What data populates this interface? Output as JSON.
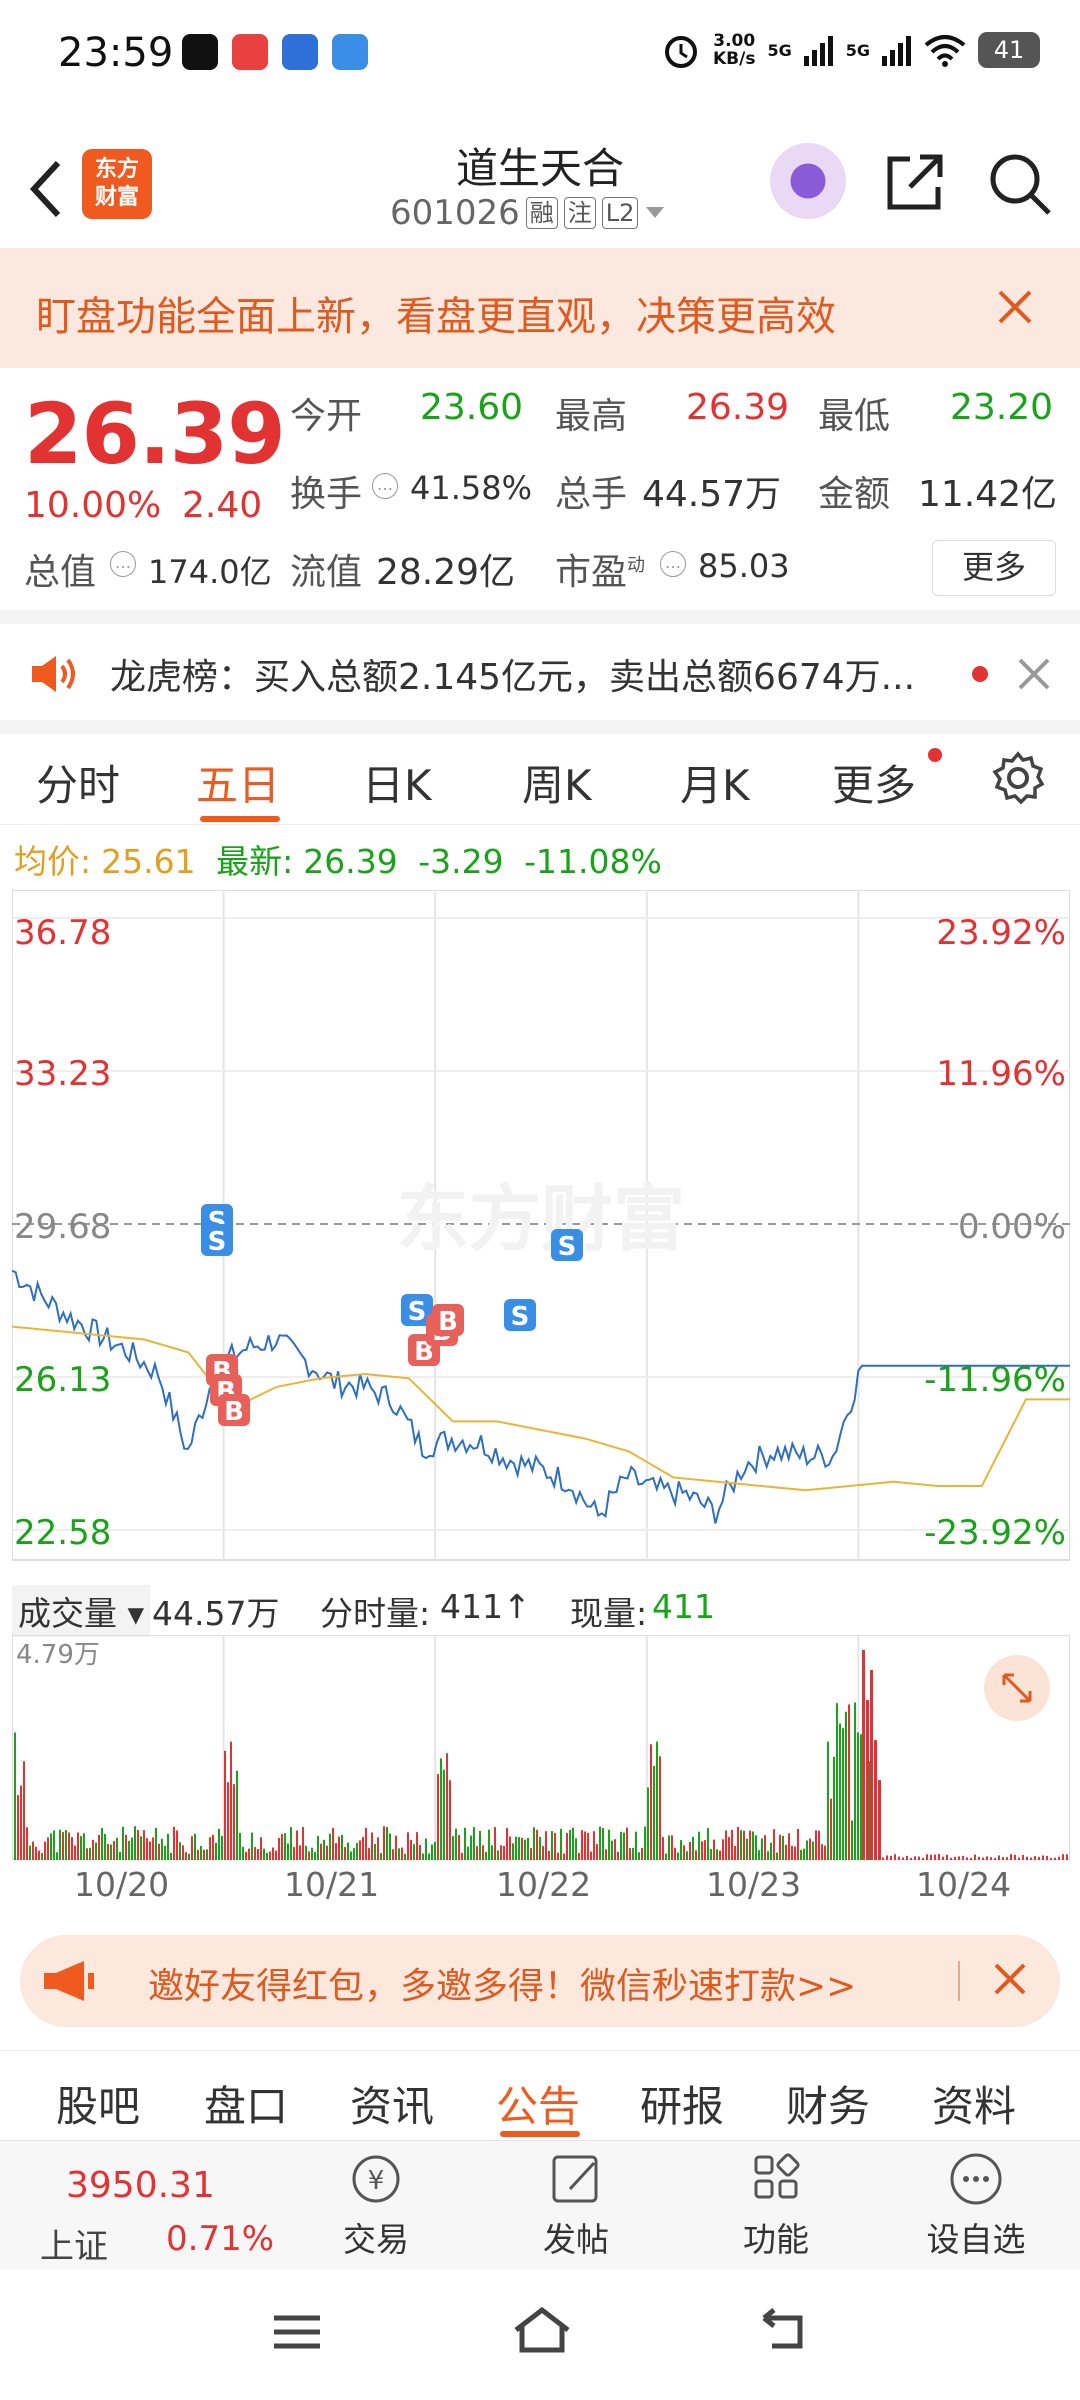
{
  "status_bar": {
    "time": "23:59",
    "speed": "3.00",
    "speed_unit": "KB/s",
    "net1": "5G",
    "net2": "5G",
    "battery": "41"
  },
  "header": {
    "name": "道生天合",
    "code": "601026",
    "tag_rong": "融",
    "tag_zhu": "注",
    "tag_l2": "L2",
    "logo_line1": "东方",
    "logo_line2": "财富"
  },
  "banner": {
    "text": "盯盘功能全面上新，看盘更直观，决策更高效"
  },
  "quote": {
    "price": "26.39",
    "change_pct": "10.00%",
    "change": "2.40",
    "open_label": "今开",
    "open": "23.60",
    "high_label": "最高",
    "high": "26.39",
    "low_label": "最低",
    "low": "23.20",
    "turnover_label": "换手",
    "turnover": "41.58%",
    "volume_label": "总手",
    "volume": "44.57万",
    "amount_label": "金额",
    "amount": "11.42亿",
    "mktcap_label": "总值",
    "mktcap": "174.0亿",
    "float_label": "流值",
    "float": "28.29亿",
    "pe_label": "市盈",
    "pe_sup": "动",
    "pe": "85.03",
    "more": "更多"
  },
  "notice": {
    "text": "龙虎榜：买入总额2.145亿元，卖出总额6674万..."
  },
  "tabs": [
    "分时",
    "五日",
    "日K",
    "周K",
    "月K",
    "更多"
  ],
  "avg": {
    "avg_label": "均价:",
    "avg": "25.61",
    "latest_label": "最新:",
    "latest": "26.39",
    "chg": "-3.29",
    "chg_pct": "-11.08%"
  },
  "chart_data": {
    "type": "line",
    "y_ticks_left": [
      "36.78",
      "33.23",
      "29.68",
      "26.13",
      "22.58"
    ],
    "y_ticks_right": [
      "23.92%",
      "11.96%",
      "0.00%",
      "-11.96%",
      "-23.92%"
    ],
    "ylim": [
      22.58,
      36.78
    ],
    "prev_close": 29.68,
    "x_labels": [
      "10/20",
      "10/21",
      "10/22",
      "10/23",
      "10/24"
    ],
    "watermark": "东方财富",
    "series": [
      {
        "values": [
          28.6,
          28.0,
          27.5,
          27.1,
          26.7,
          26.2,
          24.4,
          26.4,
          26.8,
          27.0,
          26.5,
          26.0,
          25.9,
          25.6,
          24.5,
          24.7,
          24.6,
          24.2,
          24.0,
          23.7,
          22.9,
          23.8,
          23.5,
          23.4,
          23.0,
          24.1,
          24.4,
          24.3,
          24.3,
          26.39
        ]
      },
      {
        "values": [
          27.3,
          27.2,
          27.1,
          27.0,
          26.7,
          25.4,
          25.9,
          26.1,
          26.2,
          26.1,
          25.1,
          25.1,
          24.9,
          24.7,
          24.4,
          23.8,
          23.7,
          23.6,
          23.5,
          23.6,
          23.7,
          23.6,
          23.6,
          25.61,
          25.61
        ]
      }
    ],
    "markers": [
      "S",
      "S",
      "B",
      "B",
      "B",
      "S",
      "B",
      "B",
      "B",
      "S",
      "S"
    ]
  },
  "volume": {
    "selector": "成交量",
    "total": "44.57万",
    "period_label": "分时量:",
    "period_value": "411",
    "cur_label": "现量:",
    "cur_value": "411",
    "max_label": "4.79万"
  },
  "invite": {
    "text": "邀好友得红包，多邀多得！微信秒速打款>>"
  },
  "info_tabs": [
    "股吧",
    "盘口",
    "资讯",
    "公告",
    "研报",
    "财务",
    "资料"
  ],
  "footer": {
    "index_value": "3950.31",
    "index_name": "上证",
    "index_change": "0.71%",
    "trade": "交易",
    "post": "发帖",
    "func": "功能",
    "watch": "设自选"
  }
}
